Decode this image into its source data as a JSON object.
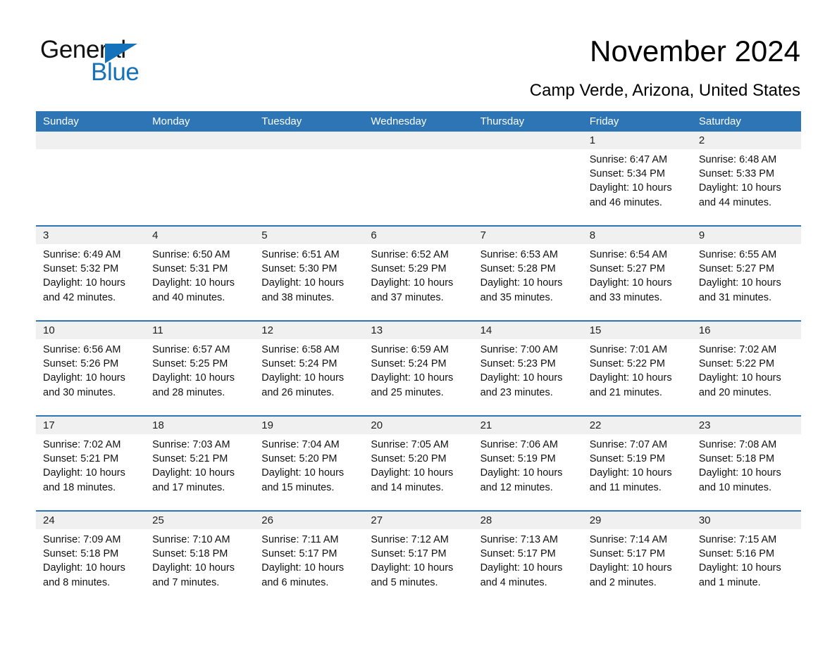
{
  "brand": {
    "word1": "General",
    "word2": "Blue"
  },
  "header": {
    "month_title": "November 2024",
    "location": "Camp Verde, Arizona, United States"
  },
  "weekday_headers": [
    "Sunday",
    "Monday",
    "Tuesday",
    "Wednesday",
    "Thursday",
    "Friday",
    "Saturday"
  ],
  "colors": {
    "header_blue": "#2E75B6",
    "brand_blue": "#1372BA",
    "daynum_band": "#F0F0F0",
    "row_divider": "#2E75B6"
  },
  "weeks": [
    [
      {
        "day": "",
        "empty": true
      },
      {
        "day": "",
        "empty": true
      },
      {
        "day": "",
        "empty": true
      },
      {
        "day": "",
        "empty": true
      },
      {
        "day": "",
        "empty": true
      },
      {
        "day": "1",
        "sunrise": "Sunrise: 6:47 AM",
        "sunset": "Sunset: 5:34 PM",
        "daylight_1": "Daylight: 10 hours",
        "daylight_2": "and 46 minutes."
      },
      {
        "day": "2",
        "sunrise": "Sunrise: 6:48 AM",
        "sunset": "Sunset: 5:33 PM",
        "daylight_1": "Daylight: 10 hours",
        "daylight_2": "and 44 minutes."
      }
    ],
    [
      {
        "day": "3",
        "sunrise": "Sunrise: 6:49 AM",
        "sunset": "Sunset: 5:32 PM",
        "daylight_1": "Daylight: 10 hours",
        "daylight_2": "and 42 minutes."
      },
      {
        "day": "4",
        "sunrise": "Sunrise: 6:50 AM",
        "sunset": "Sunset: 5:31 PM",
        "daylight_1": "Daylight: 10 hours",
        "daylight_2": "and 40 minutes."
      },
      {
        "day": "5",
        "sunrise": "Sunrise: 6:51 AM",
        "sunset": "Sunset: 5:30 PM",
        "daylight_1": "Daylight: 10 hours",
        "daylight_2": "and 38 minutes."
      },
      {
        "day": "6",
        "sunrise": "Sunrise: 6:52 AM",
        "sunset": "Sunset: 5:29 PM",
        "daylight_1": "Daylight: 10 hours",
        "daylight_2": "and 37 minutes."
      },
      {
        "day": "7",
        "sunrise": "Sunrise: 6:53 AM",
        "sunset": "Sunset: 5:28 PM",
        "daylight_1": "Daylight: 10 hours",
        "daylight_2": "and 35 minutes."
      },
      {
        "day": "8",
        "sunrise": "Sunrise: 6:54 AM",
        "sunset": "Sunset: 5:27 PM",
        "daylight_1": "Daylight: 10 hours",
        "daylight_2": "and 33 minutes."
      },
      {
        "day": "9",
        "sunrise": "Sunrise: 6:55 AM",
        "sunset": "Sunset: 5:27 PM",
        "daylight_1": "Daylight: 10 hours",
        "daylight_2": "and 31 minutes."
      }
    ],
    [
      {
        "day": "10",
        "sunrise": "Sunrise: 6:56 AM",
        "sunset": "Sunset: 5:26 PM",
        "daylight_1": "Daylight: 10 hours",
        "daylight_2": "and 30 minutes."
      },
      {
        "day": "11",
        "sunrise": "Sunrise: 6:57 AM",
        "sunset": "Sunset: 5:25 PM",
        "daylight_1": "Daylight: 10 hours",
        "daylight_2": "and 28 minutes."
      },
      {
        "day": "12",
        "sunrise": "Sunrise: 6:58 AM",
        "sunset": "Sunset: 5:24 PM",
        "daylight_1": "Daylight: 10 hours",
        "daylight_2": "and 26 minutes."
      },
      {
        "day": "13",
        "sunrise": "Sunrise: 6:59 AM",
        "sunset": "Sunset: 5:24 PM",
        "daylight_1": "Daylight: 10 hours",
        "daylight_2": "and 25 minutes."
      },
      {
        "day": "14",
        "sunrise": "Sunrise: 7:00 AM",
        "sunset": "Sunset: 5:23 PM",
        "daylight_1": "Daylight: 10 hours",
        "daylight_2": "and 23 minutes."
      },
      {
        "day": "15",
        "sunrise": "Sunrise: 7:01 AM",
        "sunset": "Sunset: 5:22 PM",
        "daylight_1": "Daylight: 10 hours",
        "daylight_2": "and 21 minutes."
      },
      {
        "day": "16",
        "sunrise": "Sunrise: 7:02 AM",
        "sunset": "Sunset: 5:22 PM",
        "daylight_1": "Daylight: 10 hours",
        "daylight_2": "and 20 minutes."
      }
    ],
    [
      {
        "day": "17",
        "sunrise": "Sunrise: 7:02 AM",
        "sunset": "Sunset: 5:21 PM",
        "daylight_1": "Daylight: 10 hours",
        "daylight_2": "and 18 minutes."
      },
      {
        "day": "18",
        "sunrise": "Sunrise: 7:03 AM",
        "sunset": "Sunset: 5:21 PM",
        "daylight_1": "Daylight: 10 hours",
        "daylight_2": "and 17 minutes."
      },
      {
        "day": "19",
        "sunrise": "Sunrise: 7:04 AM",
        "sunset": "Sunset: 5:20 PM",
        "daylight_1": "Daylight: 10 hours",
        "daylight_2": "and 15 minutes."
      },
      {
        "day": "20",
        "sunrise": "Sunrise: 7:05 AM",
        "sunset": "Sunset: 5:20 PM",
        "daylight_1": "Daylight: 10 hours",
        "daylight_2": "and 14 minutes."
      },
      {
        "day": "21",
        "sunrise": "Sunrise: 7:06 AM",
        "sunset": "Sunset: 5:19 PM",
        "daylight_1": "Daylight: 10 hours",
        "daylight_2": "and 12 minutes."
      },
      {
        "day": "22",
        "sunrise": "Sunrise: 7:07 AM",
        "sunset": "Sunset: 5:19 PM",
        "daylight_1": "Daylight: 10 hours",
        "daylight_2": "and 11 minutes."
      },
      {
        "day": "23",
        "sunrise": "Sunrise: 7:08 AM",
        "sunset": "Sunset: 5:18 PM",
        "daylight_1": "Daylight: 10 hours",
        "daylight_2": "and 10 minutes."
      }
    ],
    [
      {
        "day": "24",
        "sunrise": "Sunrise: 7:09 AM",
        "sunset": "Sunset: 5:18 PM",
        "daylight_1": "Daylight: 10 hours",
        "daylight_2": "and 8 minutes."
      },
      {
        "day": "25",
        "sunrise": "Sunrise: 7:10 AM",
        "sunset": "Sunset: 5:18 PM",
        "daylight_1": "Daylight: 10 hours",
        "daylight_2": "and 7 minutes."
      },
      {
        "day": "26",
        "sunrise": "Sunrise: 7:11 AM",
        "sunset": "Sunset: 5:17 PM",
        "daylight_1": "Daylight: 10 hours",
        "daylight_2": "and 6 minutes."
      },
      {
        "day": "27",
        "sunrise": "Sunrise: 7:12 AM",
        "sunset": "Sunset: 5:17 PM",
        "daylight_1": "Daylight: 10 hours",
        "daylight_2": "and 5 minutes."
      },
      {
        "day": "28",
        "sunrise": "Sunrise: 7:13 AM",
        "sunset": "Sunset: 5:17 PM",
        "daylight_1": "Daylight: 10 hours",
        "daylight_2": "and 4 minutes."
      },
      {
        "day": "29",
        "sunrise": "Sunrise: 7:14 AM",
        "sunset": "Sunset: 5:17 PM",
        "daylight_1": "Daylight: 10 hours",
        "daylight_2": "and 2 minutes."
      },
      {
        "day": "30",
        "sunrise": "Sunrise: 7:15 AM",
        "sunset": "Sunset: 5:16 PM",
        "daylight_1": "Daylight: 10 hours",
        "daylight_2": "and 1 minute."
      }
    ]
  ]
}
